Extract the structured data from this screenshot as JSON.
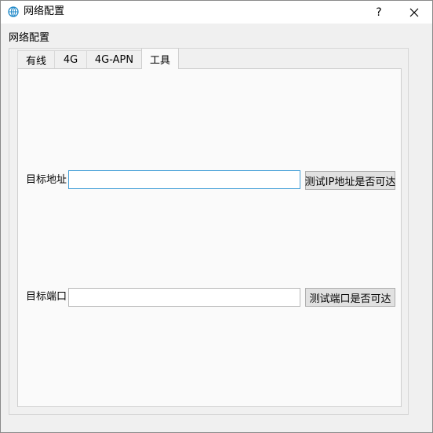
{
  "window": {
    "title": "网络配置",
    "help_label": "?",
    "close_label": "✕"
  },
  "group": {
    "title": "网络配置"
  },
  "tabs": [
    {
      "label": "有线",
      "active": false
    },
    {
      "label": "4G",
      "active": false
    },
    {
      "label": "4G-APN",
      "active": false
    },
    {
      "label": "工具",
      "active": true
    }
  ],
  "tools": {
    "target_address_label": "目标地址",
    "target_address_value": "",
    "test_ip_button": "测试IP地址是否可达",
    "target_port_label": "目标端口",
    "target_port_value": "",
    "test_port_button": "测试端口是否可达"
  },
  "colors": {
    "accent": "#46a0d8",
    "icon": "#1e88c8"
  },
  "icons": {
    "app": "network-globe-icon"
  }
}
